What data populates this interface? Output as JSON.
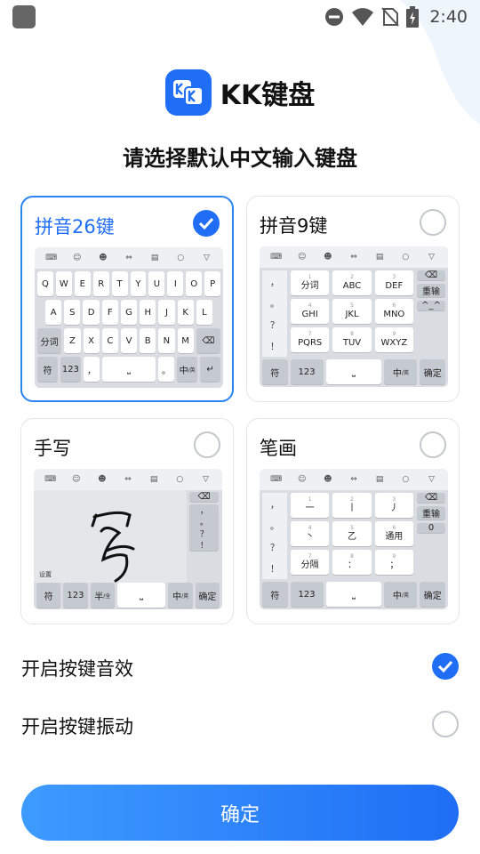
{
  "status_bar": {
    "time": "2:40",
    "icons": [
      "dnd-icon",
      "wifi-icon",
      "no-sim-icon",
      "battery-charging-icon"
    ]
  },
  "brand": {
    "name": "KK键盘",
    "logo_letters": "KK",
    "color": "#1f6ef5"
  },
  "headline": "请选择默认中文输入键盘",
  "layouts": [
    {
      "title": "拼音26键",
      "selected": true
    },
    {
      "title": "拼音9键",
      "selected": false
    },
    {
      "title": "手写",
      "selected": false
    },
    {
      "title": "笔画",
      "selected": false
    }
  ],
  "toolbar_icons": [
    "keyboard-switch-icon",
    "emoji-icon",
    "smile-icon",
    "cursor-icon",
    "clipboard-icon",
    "search-icon",
    "collapse-icon"
  ],
  "qwerty": {
    "row1": [
      "Q",
      "W",
      "E",
      "R",
      "T",
      "Y",
      "U",
      "I",
      "O",
      "P"
    ],
    "row2": [
      "A",
      "S",
      "D",
      "F",
      "G",
      "H",
      "J",
      "K",
      "L"
    ],
    "row3_left": "分词",
    "row3": [
      "Z",
      "X",
      "C",
      "V",
      "B",
      "N",
      "M"
    ],
    "bottom": {
      "symbol": "符",
      "num": "123",
      "comma": "，",
      "period": "。",
      "lang": "中",
      "lang_sub": "/英"
    }
  },
  "nine_key": {
    "left_punct": [
      "，",
      "。",
      "？",
      "！"
    ],
    "keys": [
      {
        "n": "1",
        "label": "分词"
      },
      {
        "n": "2",
        "label": "ABC"
      },
      {
        "n": "3",
        "label": "DEF"
      },
      {
        "n": "4",
        "label": "GHI"
      },
      {
        "n": "5",
        "label": "JKL"
      },
      {
        "n": "6",
        "label": "MNO"
      },
      {
        "n": "7",
        "label": "PQRS"
      },
      {
        "n": "8",
        "label": "TUV"
      },
      {
        "n": "9",
        "label": "WXYZ"
      }
    ],
    "right": [
      "重输",
      "^_^"
    ],
    "bottom": {
      "symbol": "符",
      "num": "123",
      "lang": "中",
      "lang_sub": "/英",
      "confirm": "确定"
    }
  },
  "handwriting": {
    "sample_char": "写",
    "settings_label": "设置",
    "right_punct": [
      "，",
      "。",
      "？",
      "！"
    ],
    "bottom": {
      "symbol": "符",
      "num": "123",
      "half": "半",
      "half_sub": "/全",
      "lang": "中",
      "lang_sub": "/英",
      "confirm": "确定"
    }
  },
  "stroke": {
    "left_punct": [
      "，",
      "。",
      "？",
      "！"
    ],
    "keys": [
      {
        "n": "1",
        "label": "一"
      },
      {
        "n": "2",
        "label": "丨"
      },
      {
        "n": "3",
        "label": "丿"
      },
      {
        "n": "4",
        "label": "丶"
      },
      {
        "n": "5",
        "label": "乙"
      },
      {
        "n": "6",
        "label": "通用"
      },
      {
        "n": "7",
        "label": "分隔"
      },
      {
        "n": "8",
        "label": "："
      },
      {
        "n": "9",
        "label": "；"
      }
    ],
    "right": [
      "重输",
      "0"
    ],
    "bottom": {
      "symbol": "符",
      "num": "123",
      "lang": "中",
      "lang_sub": "/英",
      "confirm": "确定"
    }
  },
  "options": [
    {
      "label": "开启按键音效",
      "checked": true
    },
    {
      "label": "开启按键振动",
      "checked": false
    }
  ],
  "confirm_label": "确定"
}
